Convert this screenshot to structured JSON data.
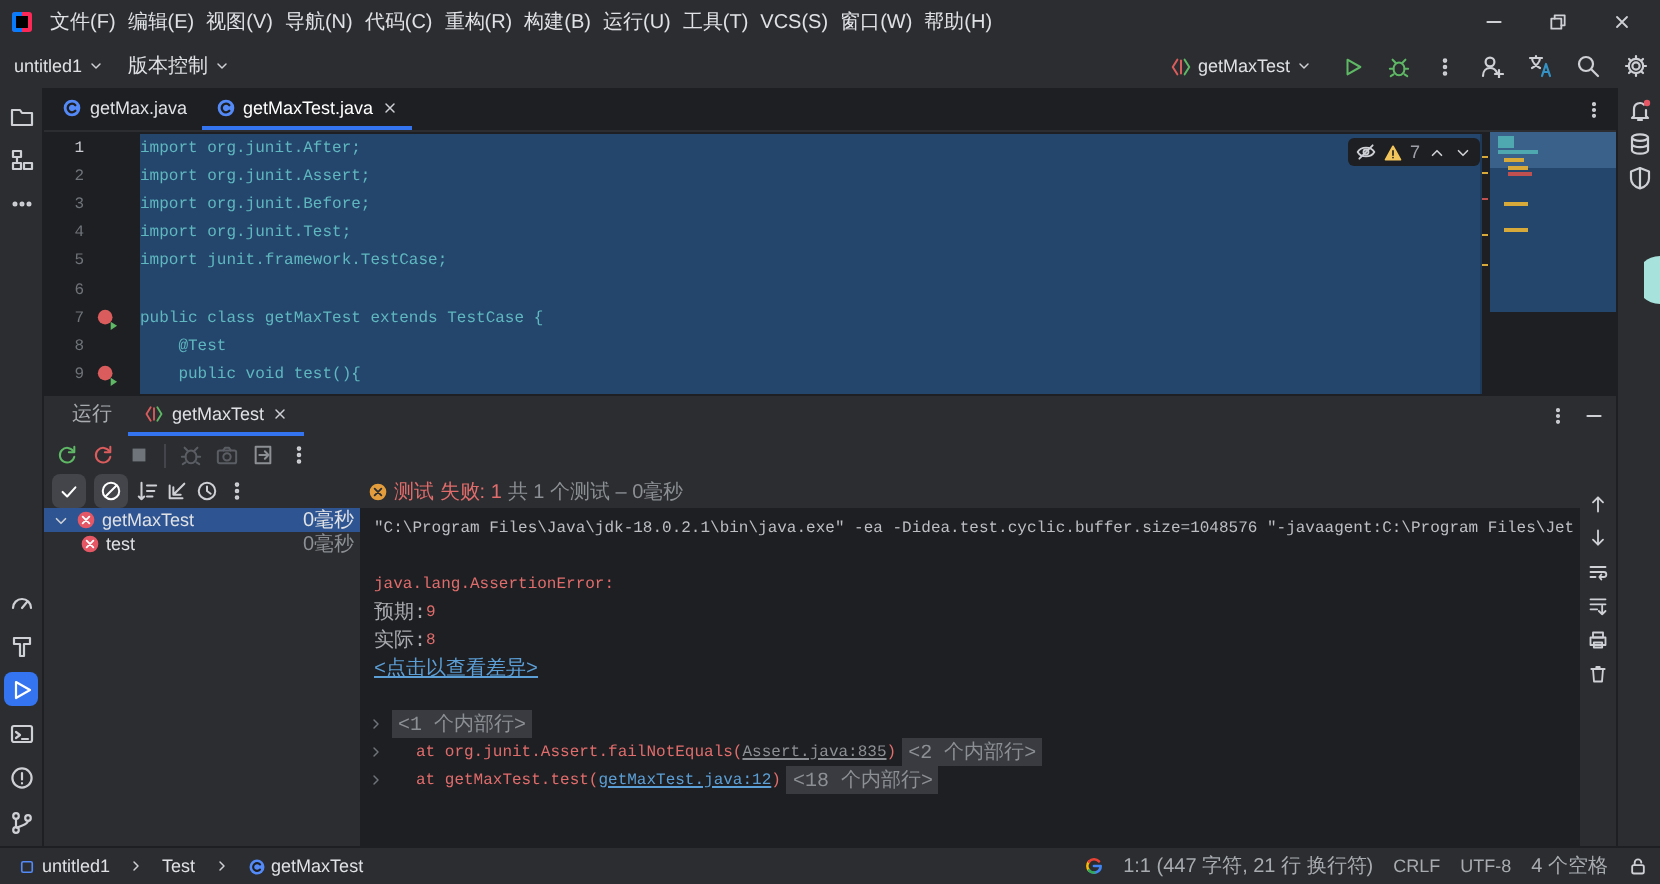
{
  "title_bar": {
    "menus": [
      "文件(F)",
      "编辑(E)",
      "视图(V)",
      "导航(N)",
      "代码(C)",
      "重构(R)",
      "构建(B)",
      "运行(U)",
      "工具(T)",
      "VCS(S)",
      "窗口(W)",
      "帮助(H)"
    ]
  },
  "toolbar": {
    "project": "untitled1",
    "vcs": "版本控制",
    "run_config": "getMaxTest"
  },
  "left_toolbar": {
    "top": [
      {
        "kind": "project",
        "selected": false
      },
      {
        "kind": "structure",
        "selected": false
      },
      {
        "kind": "more",
        "selected": false
      }
    ],
    "bottom": [
      {
        "kind": "profiler",
        "selected": false
      },
      {
        "kind": "build",
        "selected": false
      },
      {
        "kind": "run",
        "selected": true
      },
      {
        "kind": "terminal",
        "selected": false
      },
      {
        "kind": "problems",
        "selected": false
      },
      {
        "kind": "git",
        "selected": false
      }
    ]
  },
  "editor": {
    "tabs": [
      {
        "label": "getMax.java",
        "selected": false
      },
      {
        "label": "getMaxTest.java",
        "selected": true
      }
    ],
    "warnings": "7",
    "lines": [
      {
        "number": "1",
        "text": "import org.junit.After;",
        "current": true,
        "test_failed": false
      },
      {
        "number": "2",
        "text": "import org.junit.Assert;",
        "current": false,
        "test_failed": false
      },
      {
        "number": "3",
        "text": "import org.junit.Before;",
        "current": false,
        "test_failed": false
      },
      {
        "number": "4",
        "text": "import org.junit.Test;",
        "current": false,
        "test_failed": false
      },
      {
        "number": "5",
        "text": "import junit.framework.TestCase;",
        "current": false,
        "test_failed": false
      },
      {
        "number": "6",
        "current": false,
        "test_failed": false
      },
      {
        "number": "7",
        "text": "public class getMaxTest extends TestCase {",
        "current": false,
        "test_failed": true
      },
      {
        "number": "8",
        "text": "    @Test",
        "current": false,
        "test_failed": false
      },
      {
        "number": "9",
        "text": "    public void test(){",
        "current": false,
        "test_failed": true
      }
    ]
  },
  "run_panel": {
    "tabs": [
      {
        "label": "运行",
        "selected": false
      },
      {
        "label": "getMaxTest",
        "selected": true
      }
    ],
    "filters": [
      {
        "kind": "passed",
        "on": true
      },
      {
        "kind": "ignored",
        "on": true
      }
    ],
    "summary": {
      "status": "测试 失败: 1",
      "detail": "共 1 个测试 – 0毫秒"
    },
    "tree": [
      {
        "label": "getMaxTest",
        "time": "0毫秒",
        "failed": true,
        "selected": true,
        "expanded": true,
        "children": [
          {
            "label": "test",
            "time": "0毫秒",
            "failed": true,
            "selected": false
          }
        ]
      }
    ],
    "console": [
      {
        "kind": "command",
        "text": "\"C:\\Program Files\\Java\\jdk-18.0.2.1\\bin\\java.exe\" -ea -Didea.test.cyclic.buffer.size=1048576 \"-javaagent:C:\\Program Files\\Jet"
      },
      {
        "kind": "blank"
      },
      {
        "kind": "error",
        "text": "java.lang.AssertionError:"
      },
      {
        "kind": "compare",
        "label": "预期:",
        "value": "9"
      },
      {
        "kind": "compare",
        "label": "实际:",
        "value": "8"
      },
      {
        "kind": "link",
        "text": "<点击以查看差异>"
      },
      {
        "kind": "blank"
      },
      {
        "kind": "folded",
        "text": "<1 个内部行>"
      },
      {
        "kind": "library",
        "prefix": "at org.junit.Assert.failNotEquals(",
        "link": "Assert.java:835",
        "suffix": ")",
        "folded": "<2 个内部行>"
      },
      {
        "kind": "stack",
        "prefix": "at getMaxTest.test(",
        "link": "getMaxTest.java:12",
        "suffix": ")",
        "folded": "<18 个内部行>"
      }
    ]
  },
  "status_bar": {
    "breadcrumbs": [
      "untitled1",
      "Test",
      "getMaxTest"
    ],
    "position": "1:1 (447 字符, 21 行 换行符)",
    "line_separator": "CRLF",
    "encoding": "UTF-8",
    "indent": "4 个空格"
  }
}
